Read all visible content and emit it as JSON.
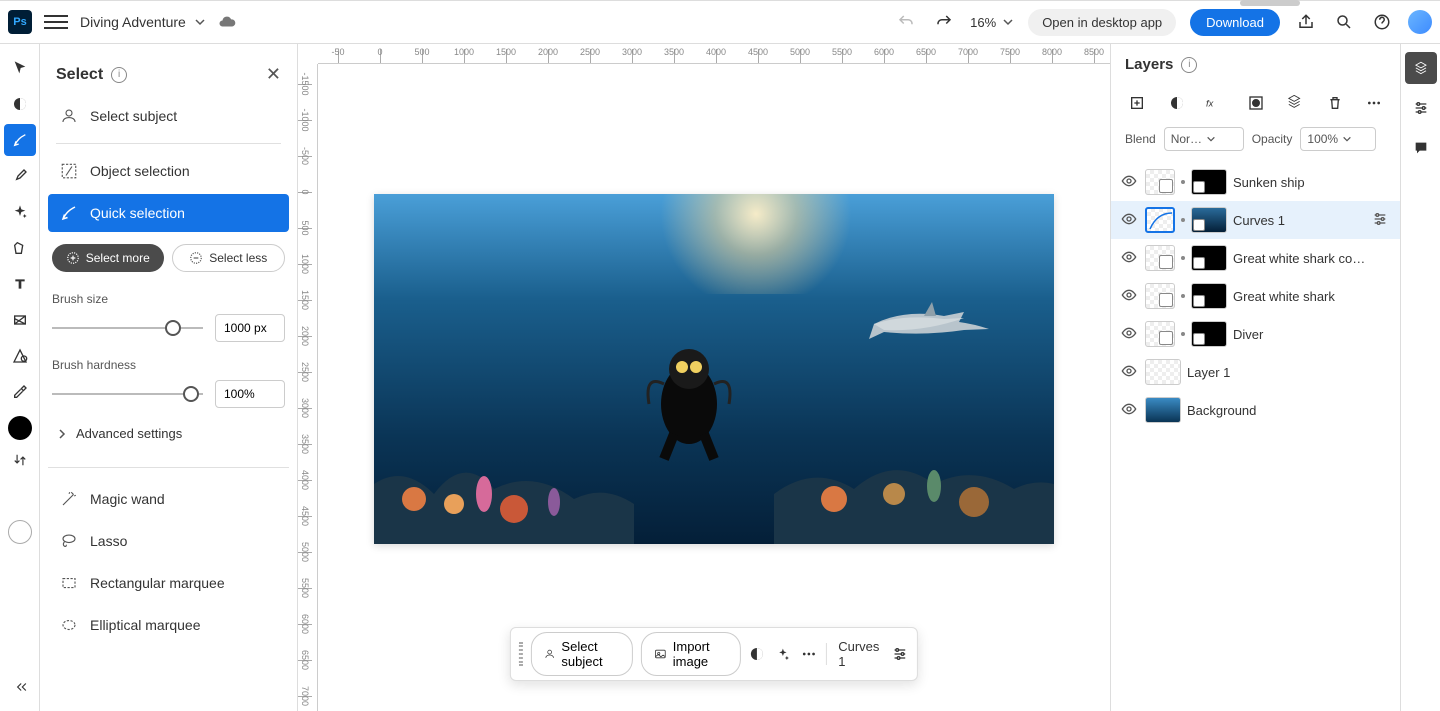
{
  "topbar": {
    "app": "Ps",
    "doc_title": "Diving Adventure",
    "zoom": "16%",
    "open_desktop": "Open in desktop app",
    "download": "Download"
  },
  "select_panel": {
    "title": "Select",
    "tools": {
      "select_subject": "Select subject",
      "object_selection": "Object selection",
      "quick_selection": "Quick selection",
      "magic_wand": "Magic wand",
      "lasso": "Lasso",
      "rectangular_marquee": "Rectangular marquee",
      "elliptical_marquee": "Elliptical marquee"
    },
    "mode": {
      "select_more": "Select more",
      "select_less": "Select less"
    },
    "brush_size_label": "Brush size",
    "brush_size_value": "1000 px",
    "brush_hardness_label": "Brush hardness",
    "brush_hardness_value": "100%",
    "advanced_settings": "Advanced settings"
  },
  "context_bar": {
    "select_subject": "Select subject",
    "import_image": "Import image",
    "current": "Curves 1"
  },
  "layers_panel": {
    "title": "Layers",
    "blend_label": "Blend",
    "blend_value": "Nor…",
    "opacity_label": "Opacity",
    "opacity_value": "100%",
    "layers": [
      {
        "name": "Sunken ship"
      },
      {
        "name": "Curves 1"
      },
      {
        "name": "Great white shark co…"
      },
      {
        "name": "Great white shark"
      },
      {
        "name": "Diver"
      },
      {
        "name": "Layer 1"
      },
      {
        "name": "Background"
      }
    ]
  },
  "ruler_h": [
    "-50",
    "0",
    "500",
    "1000",
    "1500",
    "2000",
    "2500",
    "3000",
    "3500",
    "4000",
    "4500",
    "5000",
    "5500",
    "6000",
    "6500",
    "7000",
    "7500",
    "8000",
    "8500"
  ],
  "ruler_v": [
    "-1500",
    "-1000",
    "-500",
    "0",
    "500",
    "1000",
    "1500",
    "2000",
    "2500",
    "3000",
    "3500",
    "4000",
    "4500",
    "5000",
    "5500",
    "6000",
    "6500",
    "7000"
  ]
}
